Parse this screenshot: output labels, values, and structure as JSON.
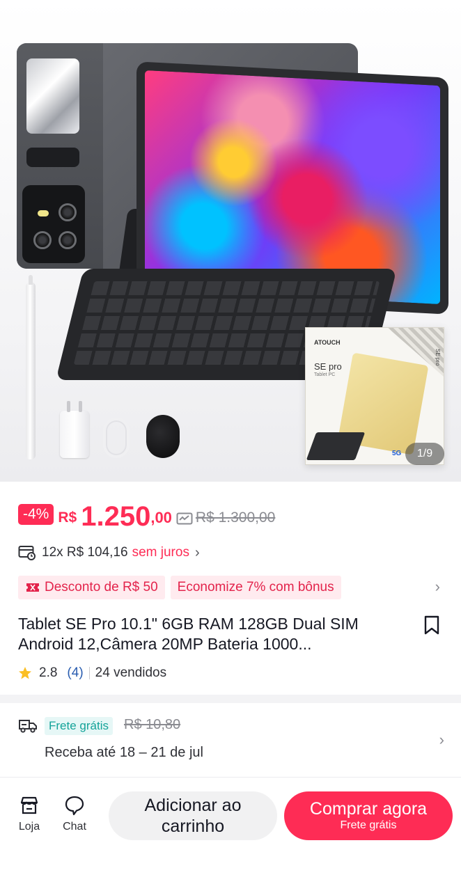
{
  "gallery": {
    "counter": "1/9",
    "box": {
      "brand": "ATOUCH",
      "model": "SE pro",
      "subtitle": "Tablet PC",
      "network": "5G"
    }
  },
  "price": {
    "discount_badge": "-4%",
    "currency": "R$",
    "integer": "1.250",
    "decimal": ",00",
    "original": "R$ 1.300,00",
    "accent_color": "#fe2c55"
  },
  "installments": {
    "text": "12x R$ 104,16",
    "highlight": "sem juros",
    "icon": "credit-card-calendar-icon"
  },
  "promotions": [
    {
      "label": "Desconto de R$ 50",
      "icon": "ticket-icon"
    },
    {
      "label": "Economize 7% com bônus"
    }
  ],
  "product": {
    "title": "Tablet SE Pro 10.1\" 6GB RAM 128GB Dual SIM Android 12,Câmera 20MP Bateria 1000...",
    "rating": "2.8",
    "review_count": "(4)",
    "sold": "24 vendidos"
  },
  "shipping": {
    "free_label": "Frete grátis",
    "original_fee": "R$ 10,80",
    "delivery": "Receba até 18 – 21 de jul"
  },
  "bottom_bar": {
    "store_label": "Loja",
    "chat_label": "Chat",
    "add_to_cart": "Adicionar ao carrinho",
    "buy_now": "Comprar agora",
    "buy_now_sub": "Frete grátis"
  }
}
